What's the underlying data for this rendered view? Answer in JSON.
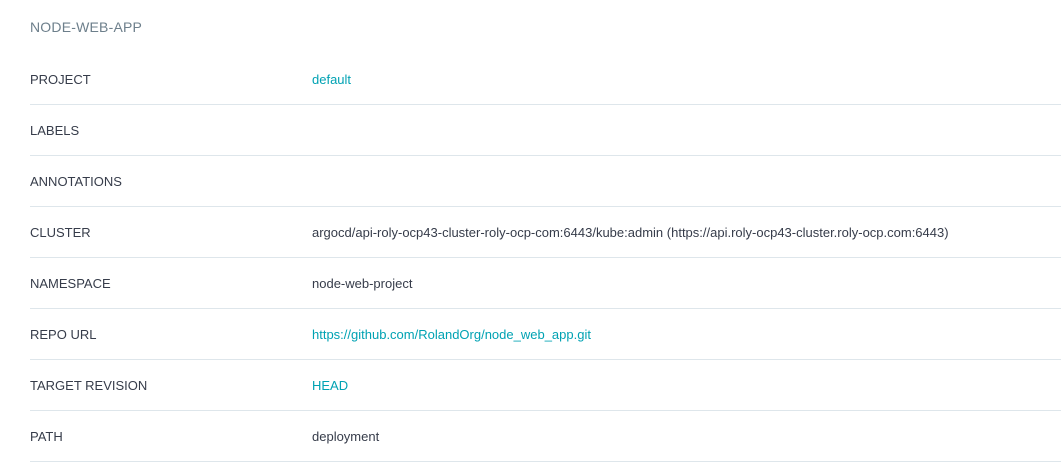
{
  "app": {
    "title": "NODE-WEB-APP"
  },
  "rows": [
    {
      "key": "PROJECT",
      "value": "default",
      "link": true
    },
    {
      "key": "LABELS",
      "value": "",
      "link": false
    },
    {
      "key": "ANNOTATIONS",
      "value": "",
      "link": false
    },
    {
      "key": "CLUSTER",
      "value": "argocd/api-roly-ocp43-cluster-roly-ocp-com:6443/kube:admin (https://api.roly-ocp43-cluster.roly-ocp.com:6443)",
      "link": false
    },
    {
      "key": "NAMESPACE",
      "value": "node-web-project",
      "link": false
    },
    {
      "key": "REPO URL",
      "value": "https://github.com/RolandOrg/node_web_app.git",
      "link": true
    },
    {
      "key": "TARGET REVISION",
      "value": "HEAD",
      "link": true
    },
    {
      "key": "PATH",
      "value": "deployment",
      "link": false
    }
  ],
  "colors": {
    "link": "#00a2b3",
    "text": "#363c4a",
    "title": "#6d7f8b",
    "divider": "#dee6eb"
  }
}
